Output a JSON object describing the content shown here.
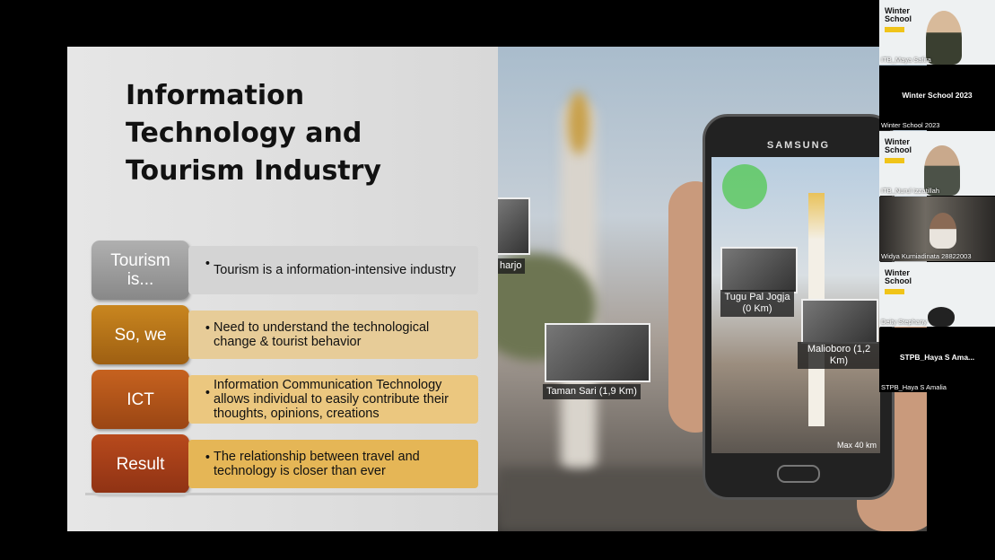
{
  "slide": {
    "title": "Information\nTechnology and\nTourism Industry",
    "rows": [
      {
        "tag": "Tourism\nis...",
        "text": "Tourism is a information-intensive industry",
        "tag_color": "#9a9a9a",
        "box_color": "#cfcfcf"
      },
      {
        "tag": "So, we",
        "text": "Need to understand the technological change & tourist behavior",
        "tag_color": "#b8731a",
        "box_color": "#e9c98d"
      },
      {
        "tag": "ICT",
        "text": "Information Communication Technology allows individual to easily contribute their thoughts, opinions, creations",
        "tag_color": "#b3561c",
        "box_color": "#ecc778"
      },
      {
        "tag": "Result",
        "text": "The relationship between travel and technology is closer than ever",
        "tag_color": "#a83e1b",
        "box_color": "#e8b44e"
      }
    ],
    "bullet": "•"
  },
  "photo": {
    "phone_brand": "SAMSUNG",
    "poi": [
      {
        "label": "Tugu Pal Jogja\n(0 Km)"
      },
      {
        "label": "Malioboro (1,2 Km)"
      },
      {
        "label": "Taman Sari (1,9 Km)"
      },
      {
        "label": "harjo"
      }
    ],
    "max_distance": "Max 40 km"
  },
  "participants": [
    {
      "label": "ITB_Maya Safira",
      "kind": "video"
    },
    {
      "label": "Winter School 2023",
      "kind": "name",
      "name": "Winter School 2023"
    },
    {
      "label": "ITB_Nurul Izzatillah",
      "kind": "video"
    },
    {
      "label": "Widya Kurniadinata 28822003",
      "kind": "video"
    },
    {
      "label": "Deity Stephany",
      "kind": "video"
    },
    {
      "label": "STPB_Haya S Amalia",
      "kind": "name",
      "name": "STPB_Haya S Ama..."
    }
  ],
  "winter_school_logo": "Winter\nSchool"
}
